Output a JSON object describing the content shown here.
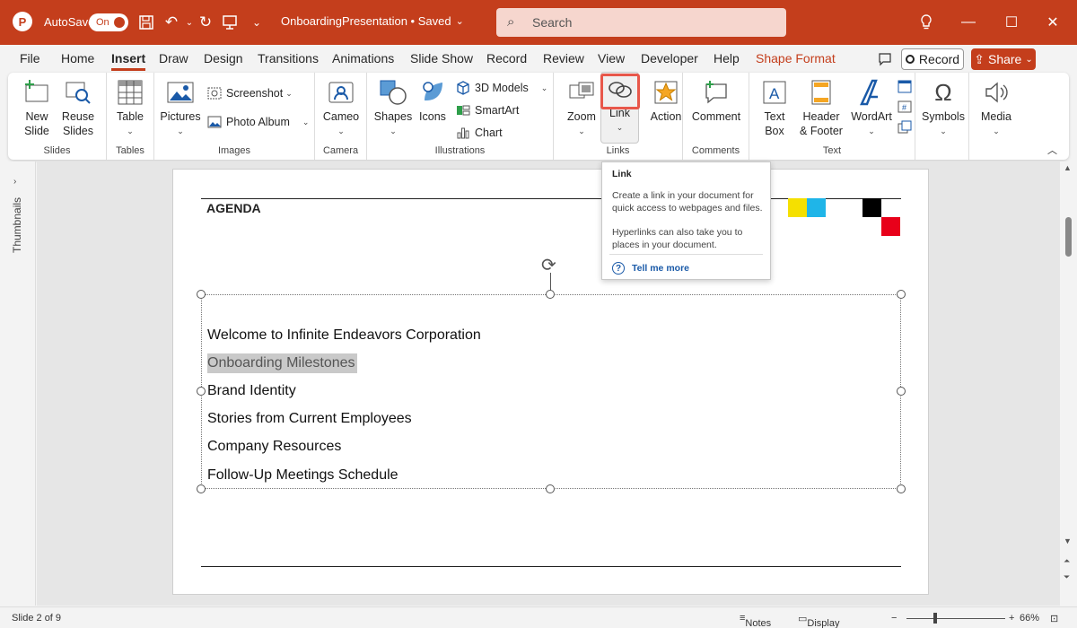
{
  "titlebar": {
    "autosave_label": "AutoSave",
    "autosave_state": "On",
    "doc_title": "OnboardingPresentation • Saved",
    "search_placeholder": "Search"
  },
  "menu": {
    "tabs": [
      "File",
      "Home",
      "Insert",
      "Draw",
      "Design",
      "Transitions",
      "Animations",
      "Slide Show",
      "Record",
      "Review",
      "View",
      "Developer",
      "Help",
      "Shape Format"
    ],
    "active_tab": "Insert",
    "record_label": "Record",
    "share_label": "Share"
  },
  "ribbon": {
    "slides": {
      "new_slide": "New Slide",
      "reuse_slides": "Reuse Slides",
      "label": "Slides"
    },
    "tables": {
      "table": "Table",
      "label": "Tables"
    },
    "images": {
      "pictures": "Pictures",
      "screenshot": "Screenshot",
      "photo_album": "Photo Album",
      "label": "Images"
    },
    "camera": {
      "cameo": "Cameo",
      "label": "Camera"
    },
    "illustrations": {
      "shapes": "Shapes",
      "icons": "Icons",
      "models": "3D Models",
      "smartart": "SmartArt",
      "chart": "Chart",
      "label": "Illustrations"
    },
    "links": {
      "zoom": "Zoom",
      "link": "Link",
      "action": "Action",
      "label": "Links"
    },
    "comments": {
      "comment": "Comment",
      "label": "Comments"
    },
    "text": {
      "textbox": "Text Box",
      "header_footer": "Header & Footer",
      "wordart": "WordArt",
      "label": "Text"
    },
    "symbols": {
      "symbols": "Symbols"
    },
    "media": {
      "media": "Media"
    }
  },
  "sidebar": {
    "thumbnails_label": "Thumbnails"
  },
  "tooltip": {
    "title": "Link",
    "text1": "Create a link in your document for quick access to webpages and files.",
    "text2": "Hyperlinks can also take you to places in your document.",
    "tell_me_more": "Tell me more"
  },
  "slide": {
    "heading": "AGENDA",
    "items": [
      "Welcome to Infinite Endeavors Corporation",
      "Onboarding Milestones",
      "Brand Identity",
      "Stories from Current Employees",
      "Company Resources",
      "Follow-Up Meetings Schedule"
    ],
    "selected_item": "Onboarding Milestones",
    "colors": {
      "yellow": "#f5e000",
      "cyan": "#1fb5e8",
      "black": "#000000",
      "red": "#e8001a"
    }
  },
  "status": {
    "slide_indicator": "Slide 2 of 9",
    "notes": "Notes",
    "display_settings": "Display Settings",
    "zoom": "66%"
  }
}
